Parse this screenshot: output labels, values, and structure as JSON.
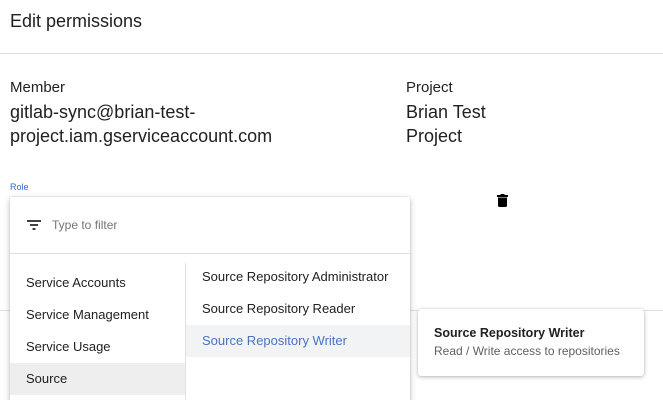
{
  "header": {
    "title": "Edit permissions"
  },
  "member": {
    "label": "Member",
    "value": "gitlab-sync@brian-test-project.iam.gserviceaccount.com",
    "value_line1": "gitlab-sync@brian-test-",
    "value_line2": "project.iam.gserviceaccount.com"
  },
  "project": {
    "label": "Project",
    "value": "Brian Test Project",
    "value_line1": "Brian Test",
    "value_line2": "Project"
  },
  "role": {
    "label": "Role",
    "delete_icon": "trash-icon"
  },
  "dropdown": {
    "filter_icon": "filter-icon",
    "filter_placeholder": "Type to filter",
    "filter_value": "",
    "categories": [
      {
        "label": "Service Accounts",
        "selected": false
      },
      {
        "label": "Service Management",
        "selected": false
      },
      {
        "label": "Service Usage",
        "selected": false
      },
      {
        "label": "Source",
        "selected": true
      }
    ],
    "roles": [
      {
        "label": "Source Repository Administrator",
        "active": false
      },
      {
        "label": "Source Repository Reader",
        "active": false
      },
      {
        "label": "Source Repository Writer",
        "active": true
      }
    ]
  },
  "tooltip": {
    "title": "Source Repository Writer",
    "description": "Read / Write access to repositories"
  },
  "colors": {
    "accent": "#4a73c6",
    "role_label": "#3367d6",
    "selected_bg": "#eeeeee",
    "divider": "#e0e0e0"
  }
}
